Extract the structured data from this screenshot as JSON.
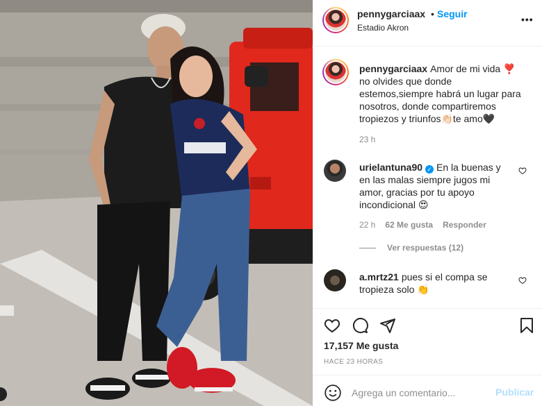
{
  "post": {
    "author": "pennygarciaax",
    "follow_label": "Seguir",
    "separator": "•",
    "location": "Estadio Akron",
    "more_label": "•••",
    "photo_alt": "",
    "caption": {
      "username": "pennygarciaax",
      "text": "Amor de mi vida ❣️no olvides que donde estemos,siempre habrá un lugar para nosotros, donde compartiremos tropiezos y triunfos👏🏻te amo🖤",
      "time": "23 h"
    },
    "comments": [
      {
        "username": "urielantuna90",
        "verified_label": "✓",
        "text": "En la buenas y en las malas siempre jugos mi amor, gracias por tu apoyo incondicional 😍",
        "time": "22 h",
        "likes": "62 Me gusta",
        "reply_label": "Responder",
        "view_replies": "Ver respuestas (12)"
      },
      {
        "username": "a.mrtz21",
        "text": "pues si el compa se tropieza solo 👏"
      }
    ],
    "likes_count": "17,157 Me gusta",
    "posted_ago": "HACE 23 HORAS",
    "add_comment_placeholder": "Agrega un comentario...",
    "publish_label": "Publicar"
  },
  "icons": [
    "heart-icon",
    "comment-icon",
    "share-icon",
    "bookmark-icon",
    "emoji-icon",
    "more-icon",
    "verified-icon"
  ],
  "colors": {
    "accent": "#0095f6",
    "text": "#262626",
    "muted": "#8e8e8e",
    "publish_disabled": "#b2dffc",
    "jeep_red": "#e0281c"
  }
}
